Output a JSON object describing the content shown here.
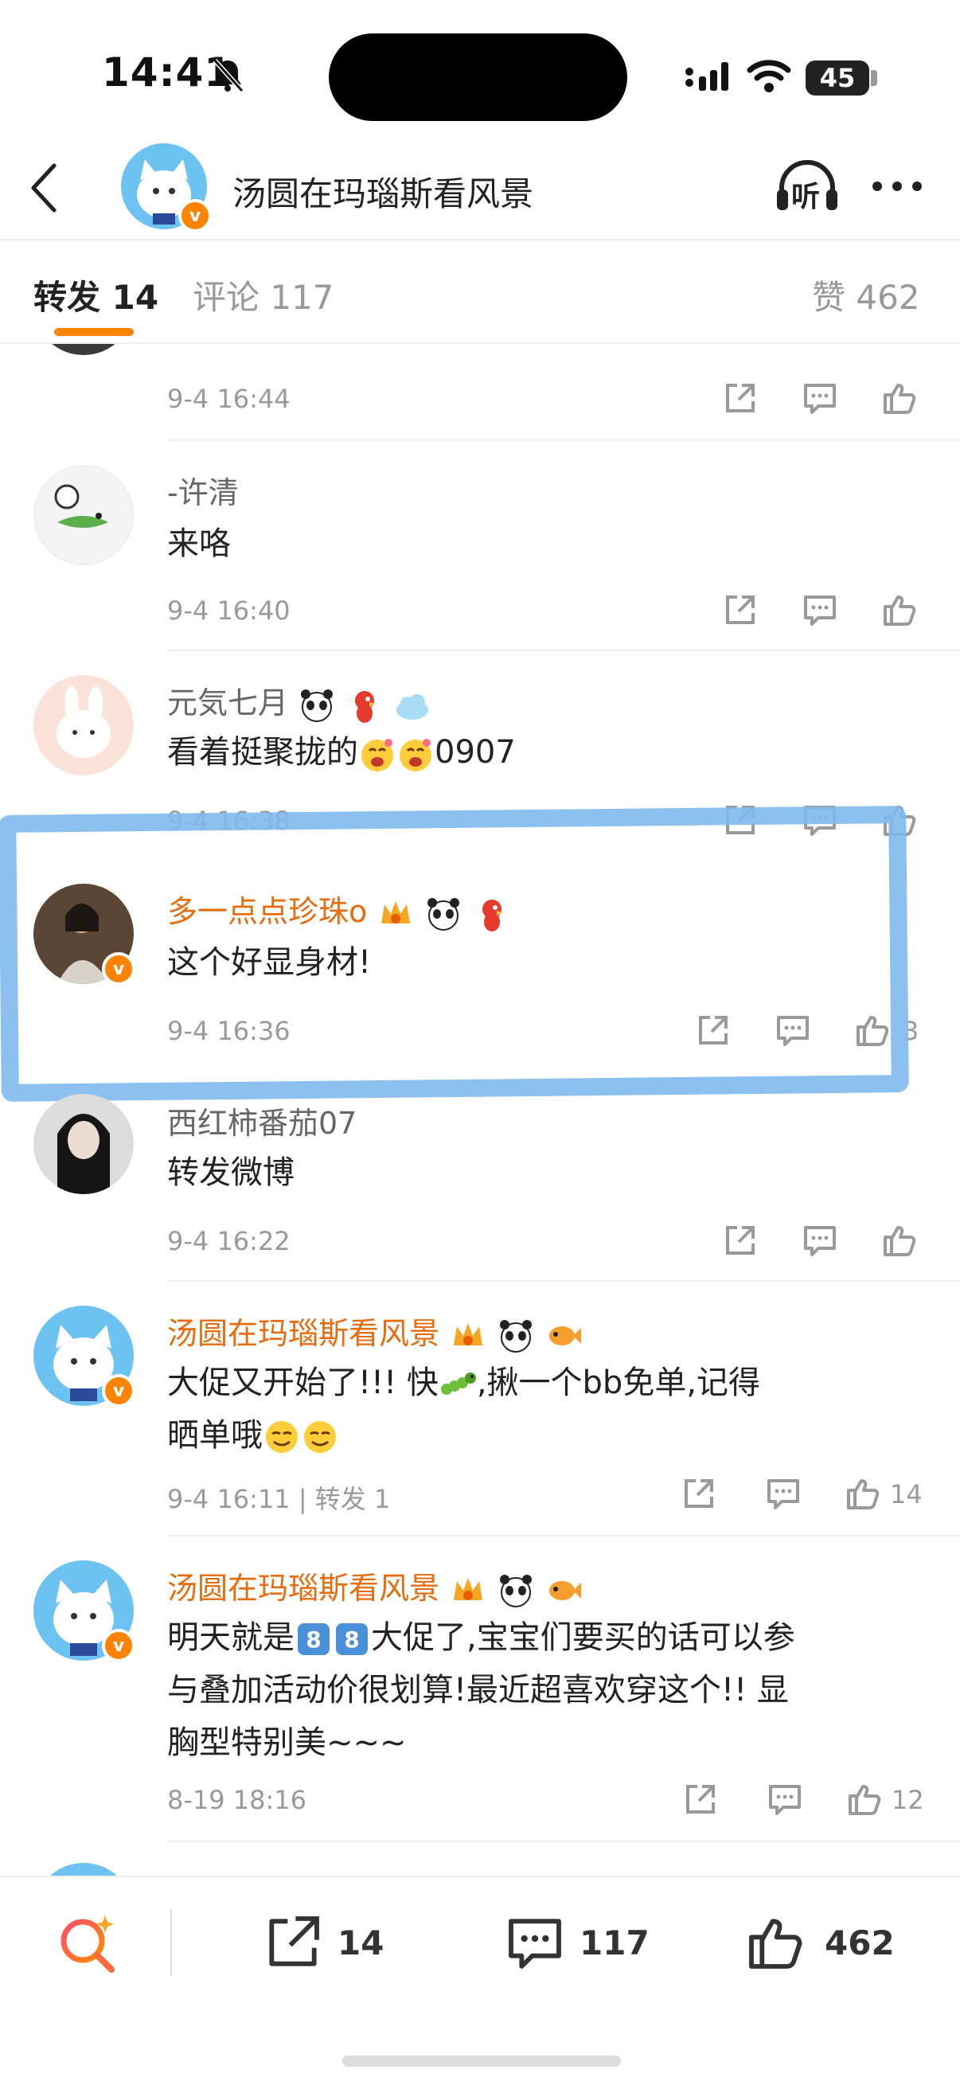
{
  "status_bar": {
    "time": "14:41",
    "battery": "45"
  },
  "header": {
    "title": "汤圆在玛瑙斯看风景",
    "listen_label": "听"
  },
  "tabs": {
    "repost": "转发 14",
    "comments": "评论 117",
    "likes": "赞 462"
  },
  "comments": [
    {
      "name": "-许清",
      "text": "来咯",
      "time": "9-4 16:40"
    },
    {
      "name": "元気七月",
      "text": "看着挺聚拢的",
      "text_suffix": "0907",
      "time": "9-4 16:38"
    },
    {
      "name": "多一点点珍珠o",
      "text": "这个好显身材!",
      "time": "9-4 16:36",
      "likes": "3"
    },
    {
      "name": "西红柿番茄07",
      "text": "转发微博",
      "time": "9-4 16:22"
    },
    {
      "name": "汤圆在玛瑙斯看风景",
      "text_line1": "大促又开始了!!! 快",
      "text_line1b": ",揪一个bb免单,记得",
      "text_line2": "晒单哦",
      "time": "9-4 16:11 | 转发 1",
      "likes": "14"
    },
    {
      "name": "汤圆在玛瑙斯看风景",
      "text_line1a": "明天就是",
      "text_line1b": "大促了,宝宝们要买的话可以参",
      "text_line2": "与叠加活动价很划算!最近超喜欢穿这个!! 显",
      "text_line3": "胸型特别美~~~",
      "time": "8-19 18:16",
      "likes": "12"
    }
  ],
  "top_partial": {
    "time": "9-4 16:44"
  },
  "bottom_bar": {
    "reposts": "14",
    "comments": "117",
    "likes": "462"
  },
  "colors": {
    "accent": "#ff8200",
    "vip_name": "#e86b0e",
    "highlight": "#80b9ec"
  }
}
